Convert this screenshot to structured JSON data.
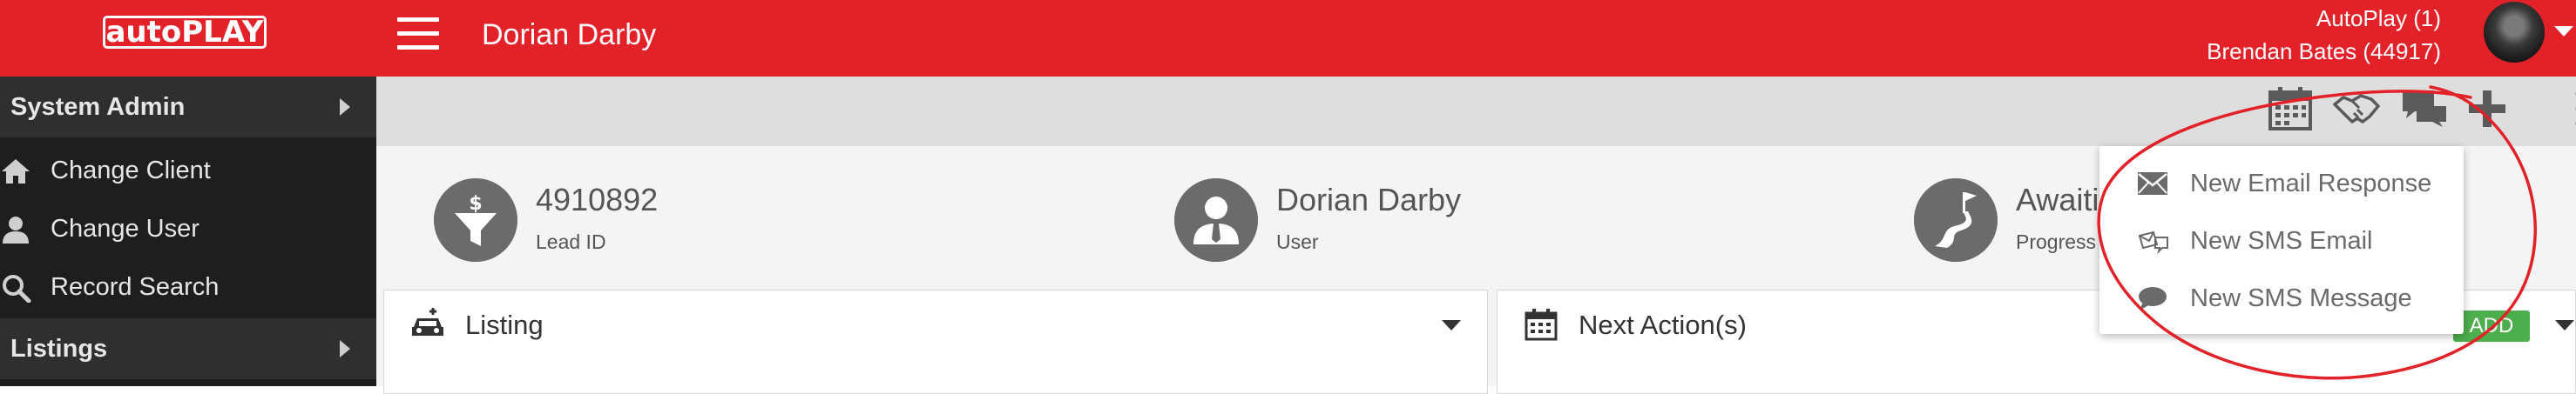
{
  "header": {
    "logo_text": "autoPLAY",
    "client_name": "Dorian Darby",
    "account_line1": "AutoPlay (1)",
    "account_line2": "Brendan Bates (44917)",
    "colors": {
      "brand_red": "#e32128",
      "sidebar_bg": "#1e1e1e"
    }
  },
  "sidebar": {
    "section_label": "System Admin",
    "items": [
      {
        "label": "Change Client",
        "icon": "home-icon"
      },
      {
        "label": "Change User",
        "icon": "user-icon"
      },
      {
        "label": "Record Search",
        "icon": "search-icon"
      }
    ],
    "next_section_label": "Listings"
  },
  "toolbar": {
    "icons": [
      "calendar-icon",
      "handshake-icon",
      "chat-icon",
      "plus-icon",
      "more-icon"
    ]
  },
  "summary": [
    {
      "value": "4910892",
      "label": "Lead ID",
      "icon": "funnel-dollar-icon"
    },
    {
      "value": "Dorian Darby",
      "label": "User",
      "icon": "user-tie-icon"
    },
    {
      "value": "Awaiti",
      "label": "Progress",
      "icon": "road-flag-icon"
    }
  ],
  "panels": {
    "listing_title": "Listing",
    "next_action_title": "Next Action(s)",
    "add_label": "ADD"
  },
  "dropdown": {
    "items": [
      {
        "label": "New Email Response",
        "icon": "envelope-icon"
      },
      {
        "label": "New SMS Email",
        "icon": "sms-email-icon"
      },
      {
        "label": "New SMS Message",
        "icon": "comment-icon"
      }
    ]
  }
}
